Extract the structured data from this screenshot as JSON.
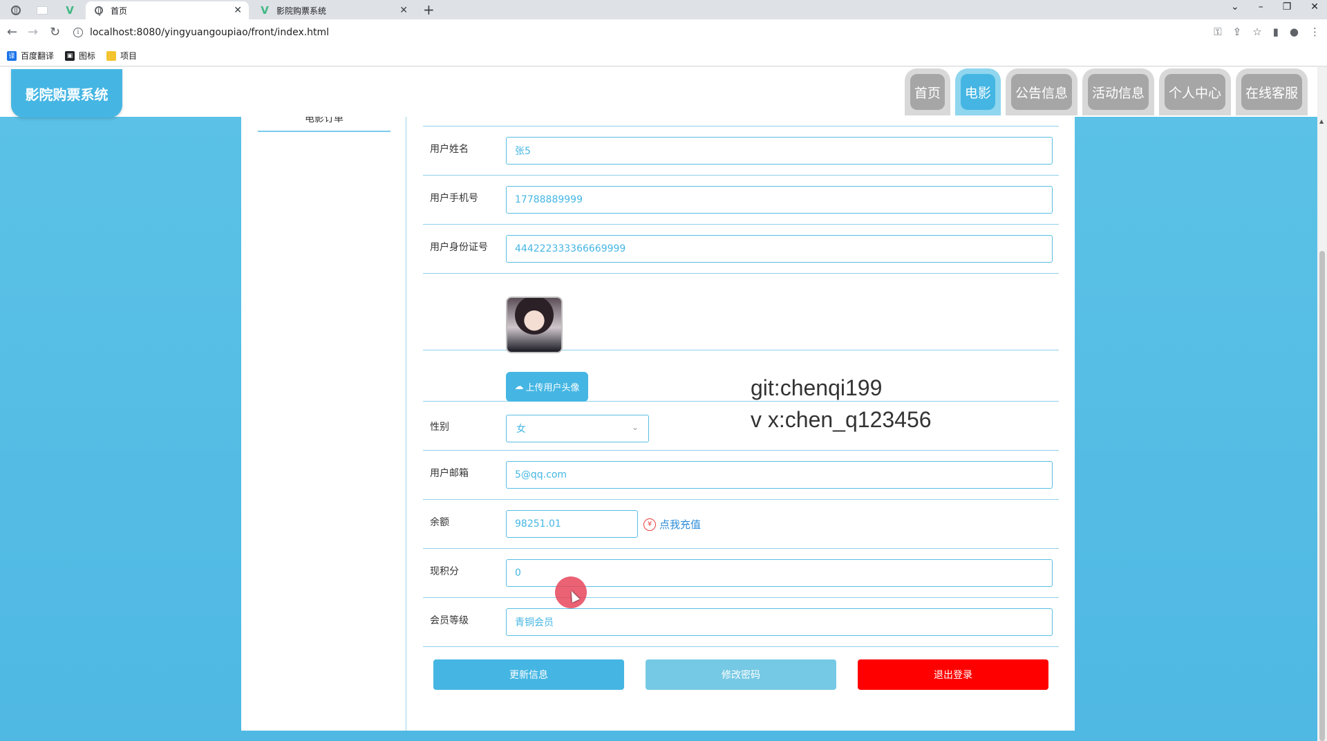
{
  "browser": {
    "tabs": [
      {
        "title": "首页",
        "close": "✕"
      },
      {
        "title": "影院购票系统",
        "close": "✕"
      }
    ],
    "new_tab": "+",
    "url": "localhost:8080/yingyuangoupiao/front/index.html",
    "bookmarks": [
      {
        "label": "百度翻译",
        "icon": "translate-icon",
        "color": "#1a73e8"
      },
      {
        "label": "图标",
        "icon": "image-icon",
        "color": "#202124"
      },
      {
        "label": "项目",
        "icon": "folder-icon",
        "color": "#f4c430"
      }
    ]
  },
  "site": {
    "logo": "影院购票系统",
    "nav": [
      "首页",
      "电影",
      "公告信息",
      "活动信息",
      "个人中心",
      "在线客服"
    ],
    "active_nav": "电影",
    "sidebar_item": "电影订单"
  },
  "profile": {
    "name_label": "用户姓名",
    "name_value": "张5",
    "phone_label": "用户手机号",
    "phone_value": "17788889999",
    "idcard_label": "用户身份证号",
    "idcard_value": "444222333366669999",
    "upload_label": "上传用户头像",
    "gender_label": "性别",
    "gender_value": "女",
    "email_label": "用户邮箱",
    "email_value": "5@qq.com",
    "balance_label": "余额",
    "balance_value": "98251.01",
    "recharge_label": "点我充值",
    "points_label": "现积分",
    "points_value": "0",
    "level_label": "会员等级",
    "level_value": "青铜会员"
  },
  "actions": {
    "update": "更新信息",
    "change_password": "修改密码",
    "logout": "退出登录"
  },
  "watermark": {
    "line1": "git:chenqi199",
    "line2": "v x:chen_q123456"
  },
  "colors": {
    "accent": "#45b6e3",
    "danger": "#ff0000",
    "page_bg": "#4fb8e3"
  }
}
